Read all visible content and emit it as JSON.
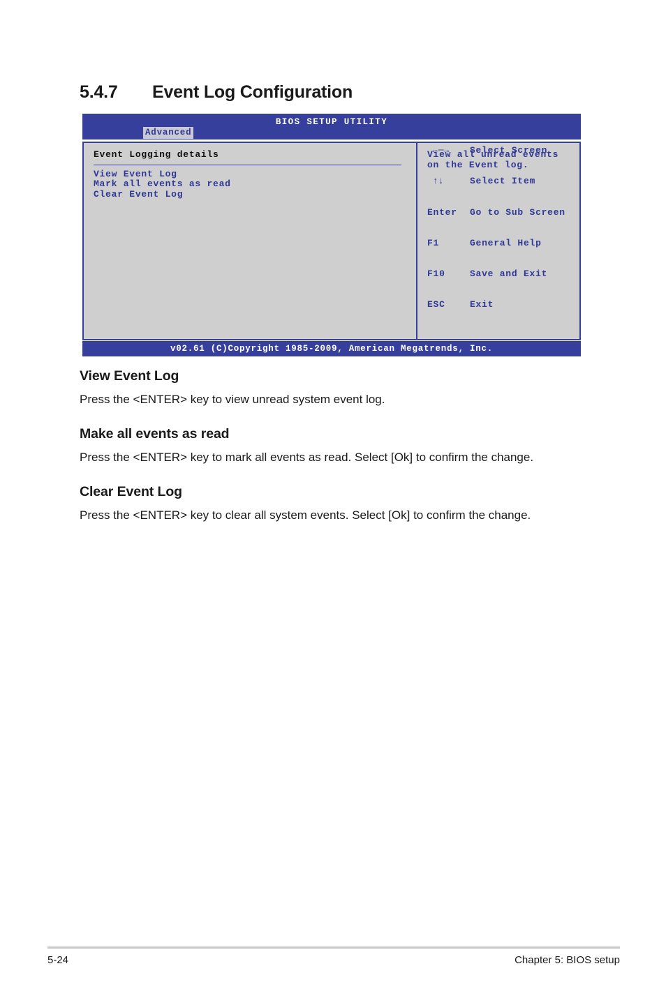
{
  "page": {
    "section_number": "5.4.7",
    "section_title": "Event Log Configuration",
    "footer_page": "5-24",
    "footer_chapter": "Chapter 5: BIOS setup"
  },
  "bios": {
    "title": "BIOS SETUP UTILITY",
    "active_tab": "Advanced",
    "left_panel": {
      "heading": "Event Logging details",
      "menu_items": [
        "View Event Log",
        "Mark all events as read",
        "Clear Event Log"
      ]
    },
    "right_panel": {
      "help_line_1": "View all unread events",
      "help_line_2": "on the Event log.",
      "keys": [
        {
          "key": "←─→",
          "action": "Select Screen"
        },
        {
          "key": "↑↓",
          "action": "Select Item"
        },
        {
          "key": "Enter",
          "action": "Go to Sub Screen"
        },
        {
          "key": "F1",
          "action": "General Help"
        },
        {
          "key": "F10",
          "action": "Save and Exit"
        },
        {
          "key": "ESC",
          "action": "Exit"
        }
      ]
    },
    "footer": "v02.61 (C)Copyright 1985-2009, American Megatrends, Inc.",
    "colors": {
      "bar_blue": "#363f9c",
      "text_blue": "#2f3896",
      "panel_gray": "#cfcfcf",
      "tab_bg": "#c9c9d4"
    }
  },
  "sections": [
    {
      "heading": "View Event Log",
      "body": "Press the <ENTER> key to view unread system event log."
    },
    {
      "heading": "Make all events as read",
      "body": "Press the <ENTER> key to mark all events as read. Select [Ok] to confirm the change."
    },
    {
      "heading": "Clear Event Log",
      "body": "Press the <ENTER> key to clear all system events. Select [Ok] to confirm the change."
    }
  ]
}
